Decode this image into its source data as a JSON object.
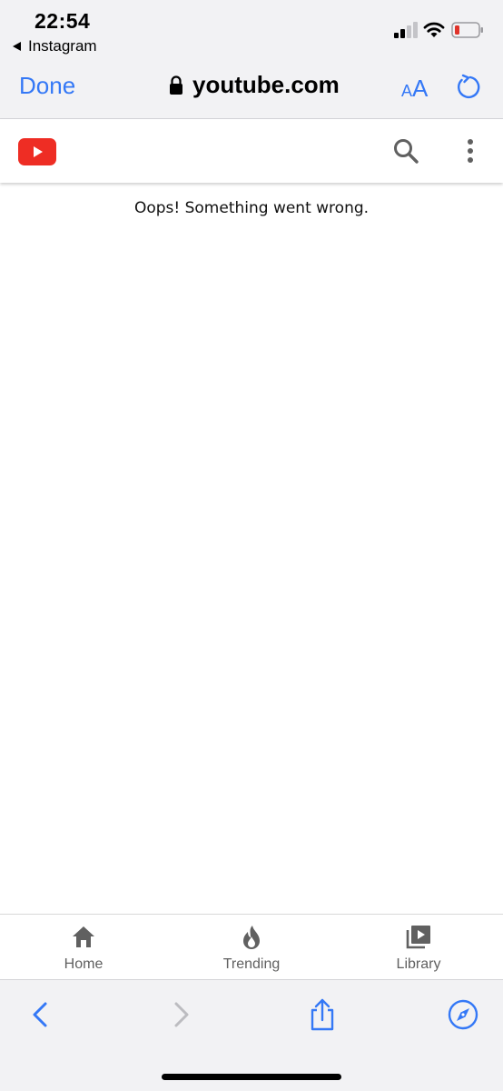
{
  "status_bar": {
    "time": "22:54",
    "back_app": "Instagram"
  },
  "safari_header": {
    "done_label": "Done",
    "url": "youtube.com",
    "text_size_small": "A",
    "text_size_big": "A"
  },
  "youtube": {
    "error_message": "Oops! Something went wrong.",
    "brand_color": "#ff0000",
    "bottom_nav": [
      {
        "label": "Home",
        "icon": "home-icon"
      },
      {
        "label": "Trending",
        "icon": "trending-flame-icon"
      },
      {
        "label": "Library",
        "icon": "library-icon"
      }
    ]
  },
  "safari_toolbar": {
    "icons": [
      "back-chevron-icon",
      "forward-chevron-icon",
      "share-icon",
      "compass-icon"
    ]
  },
  "colors": {
    "ios_blue": "#3478f6",
    "chrome_bg": "#f2f2f4",
    "battery_low": "#e0332a"
  }
}
